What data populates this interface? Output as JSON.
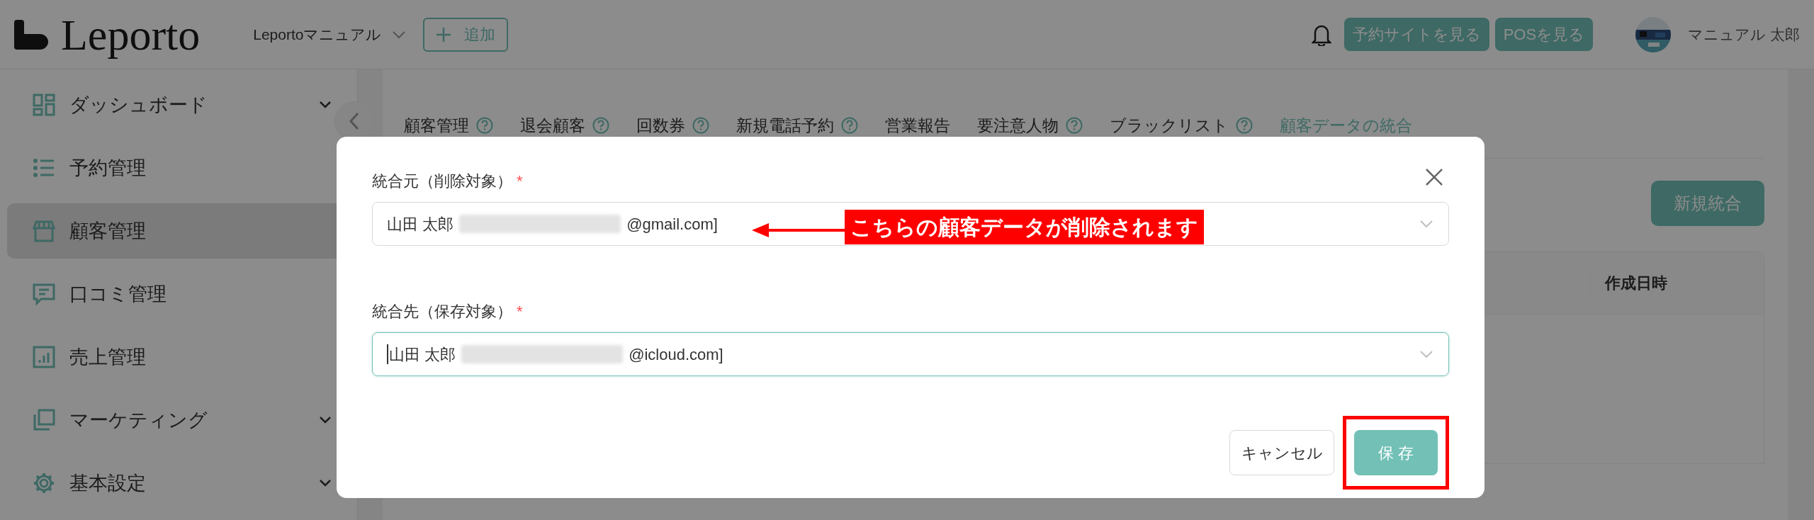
{
  "header": {
    "logo_text": "Leporto",
    "workspace": "Leportoマニュアル",
    "add_button": "追加",
    "buttons": [
      "予約サイトを見る",
      "POSを見る"
    ],
    "user_name": "マニュアル 太郎"
  },
  "sidebar": {
    "items": [
      {
        "label": "ダッシュボード",
        "expandable": true,
        "selected": false
      },
      {
        "label": "予約管理",
        "expandable": false,
        "selected": false
      },
      {
        "label": "顧客管理",
        "expandable": false,
        "selected": true
      },
      {
        "label": "口コミ管理",
        "expandable": false,
        "selected": false
      },
      {
        "label": "売上管理",
        "expandable": false,
        "selected": false
      },
      {
        "label": "マーケティング",
        "expandable": true,
        "selected": false
      },
      {
        "label": "基本設定",
        "expandable": true,
        "selected": false
      }
    ]
  },
  "tabs": [
    {
      "label": "顧客管理",
      "help": true,
      "selected": false
    },
    {
      "label": "退会顧客",
      "help": true,
      "selected": false
    },
    {
      "label": "回数券",
      "help": true,
      "selected": false
    },
    {
      "label": "新規電話予約",
      "help": true,
      "selected": false
    },
    {
      "label": "営業報告",
      "help": false,
      "selected": false
    },
    {
      "label": "要注意人物",
      "help": true,
      "selected": false
    },
    {
      "label": "ブラックリスト",
      "help": true,
      "selected": false
    },
    {
      "label": "顧客データの統合",
      "help": false,
      "selected": true
    }
  ],
  "new_button": "新規統合",
  "table": {
    "columns": [
      "作成日時"
    ]
  },
  "modal": {
    "fields": [
      {
        "label": "統合元（削除対象）",
        "required_mark": "*",
        "name": "山田 太郎",
        "email": "@gmail.com]",
        "focused": false
      },
      {
        "label": "統合先（保存対象）",
        "required_mark": "*",
        "name": "山田 太郎",
        "email": "@icloud.com]",
        "focused": true
      }
    ],
    "cancel_button": "キャンセル",
    "save_button": "保 存",
    "save_highlighted": true,
    "annotation": "こちらの顧客データが削除されます"
  }
}
